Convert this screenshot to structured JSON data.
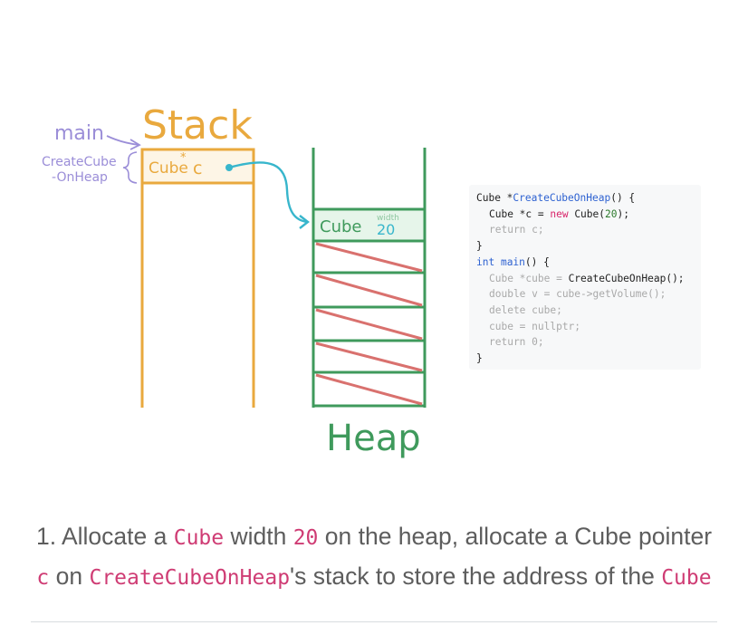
{
  "diagram": {
    "stack_title": "Stack",
    "heap_title": "Heap",
    "main_label": "main",
    "frame_label_line1": "CreateCube",
    "frame_label_line2": "-OnHeap",
    "stack_cell_type": "Cube",
    "stack_cell_star": "*",
    "stack_cell_var": "c",
    "heap_cell_type": "Cube",
    "heap_cell_field_label": "width",
    "heap_cell_field_value": "20",
    "colors": {
      "stack": "#e9a93e",
      "stack_fill": "#fdf5e6",
      "heap": "#3f9a5c",
      "heap_fill": "#e6f5ea",
      "freed_slash": "#d9716e",
      "pointer_arrow": "#38b6cc",
      "call_labels": "#9b8ed8"
    }
  },
  "code": {
    "l1_type": "Cube *",
    "l1_fn": "CreateCubeOnHeap",
    "l1_end": "() {",
    "l2_a": "Cube *c = ",
    "l2_kw": "new",
    "l2_b": " Cube(",
    "l2_num": "20",
    "l2_c": ");",
    "l3": "return c;",
    "l4": "}",
    "l5_kw": "int",
    "l5_fn": " main",
    "l5_end": "() {",
    "l6_a": "Cube *cube = ",
    "l6_b": "CreateCubeOnHeap();",
    "l7": "double v = cube->getVolume();",
    "l8": "delete cube;",
    "l9": "cube = nullptr;",
    "l10": "return 0;",
    "l11": "}"
  },
  "caption": {
    "t1": "1. Allocate a ",
    "c1": "Cube",
    "t2": " width ",
    "c2": "20",
    "t3": " on the heap, allocate a Cube pointer ",
    "c3": "c",
    "t4": " on ",
    "c4": "CreateCubeOnHeap",
    "t5": "'s stack to store the address of the ",
    "c5": "Cube"
  }
}
